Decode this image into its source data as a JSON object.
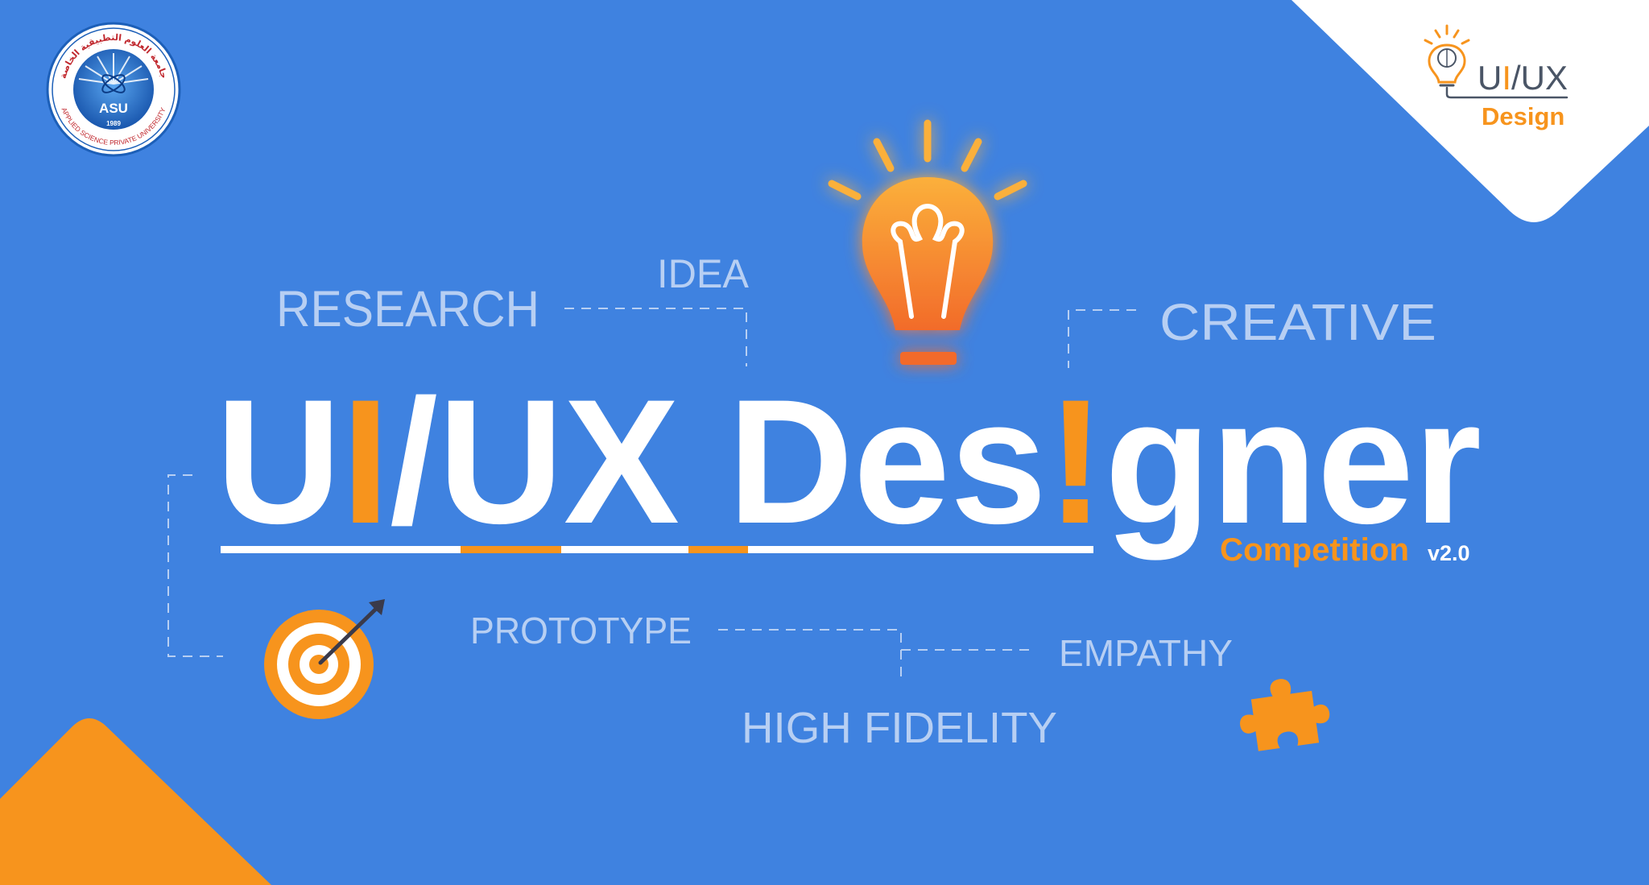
{
  "colors": {
    "background": "#3f82e0",
    "accent": "#f7941d",
    "keyword": "#b7cff3",
    "white": "#ffffff",
    "logo_text": "#4a5566"
  },
  "university_logo": {
    "abbreviation": "ASU",
    "year": "1989",
    "name_en": "APPLIED SCIENCE PRIVATE UNIVERSITY",
    "name_ar": "جامعة العلوم التطبيقية الخاصة"
  },
  "corner_logo": {
    "title_parts": [
      "U",
      "I",
      "/UX"
    ],
    "subtitle": "Design",
    "icon": "lightbulb-brain-icon"
  },
  "headline": {
    "parts": [
      "U",
      "I",
      "/UX Des",
      "!",
      "gner"
    ],
    "subtitle": "Competition",
    "version": "v2.0"
  },
  "keywords": {
    "research": "RESEARCH",
    "idea": "IDEA",
    "creative": "CREATIVE",
    "prototype": "PROTOTYPE",
    "empathy": "EMPATHY",
    "high_fidelity": "HIGH FIDELITY"
  },
  "icons": [
    "lightbulb-icon",
    "target-icon",
    "puzzle-icon"
  ]
}
